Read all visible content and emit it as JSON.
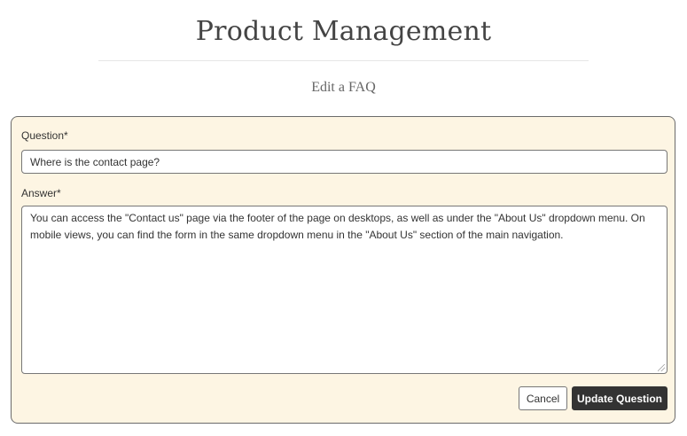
{
  "page": {
    "title": "Product Management",
    "subtitle": "Edit a FAQ"
  },
  "form": {
    "question_label": "Question*",
    "question_value": "Where is the contact page?",
    "answer_label": "Answer*",
    "answer_value": "You can access the \"Contact us\" page via the footer of the page on desktops, as well as under the \"About Us\" dropdown menu. On mobile views, you can find the form in the same dropdown menu in the \"About Us\" section of the main navigation.",
    "cancel_label": "Cancel",
    "submit_label": "Update Question"
  },
  "colors": {
    "card_background": "#fdf5e3",
    "primary_button": "#333333"
  }
}
